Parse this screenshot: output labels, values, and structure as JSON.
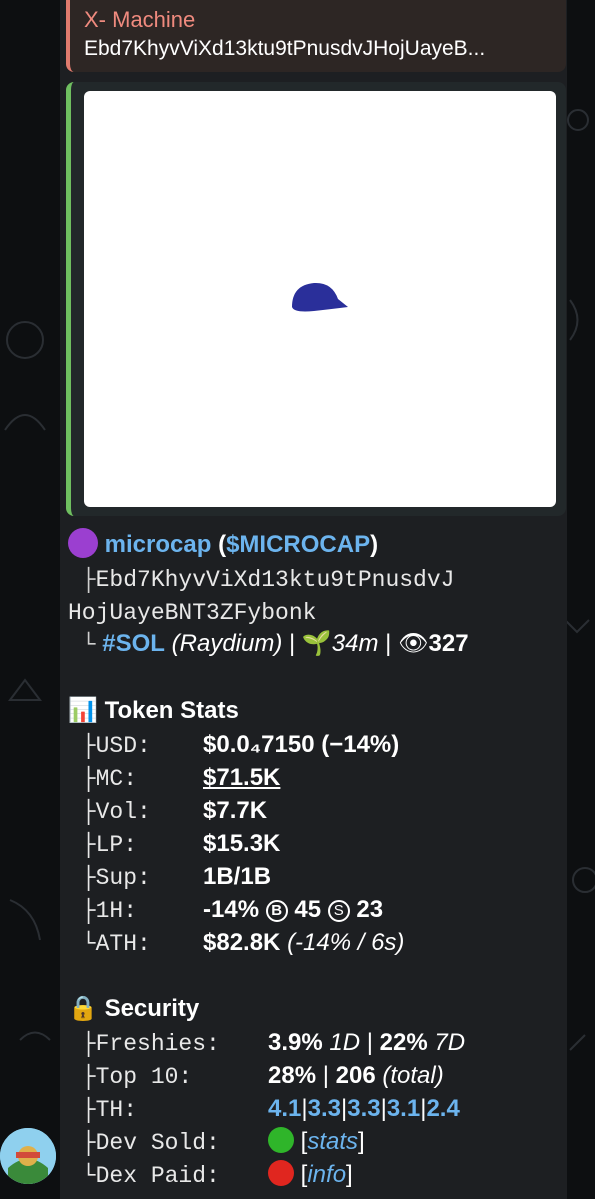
{
  "reply": {
    "author": "X- Machine",
    "text": "Ebd7KhyvViXd13ktu9tPnusdvJHojUayeB..."
  },
  "token": {
    "name": "microcap",
    "ticker": "$MICROCAP",
    "address_line1": "Ebd7KhyvViXd13ktu9tPnusdvJ",
    "address_line2": "HojUayeBNT3ZFybonk",
    "chain": "#SOL",
    "dex": "(Raydium)",
    "age": "34m",
    "views": "327",
    "sep": "|"
  },
  "stats": {
    "title": "Token Stats",
    "rows": [
      {
        "label": "USD:",
        "value": "$0.0₄7150 (−14%)"
      },
      {
        "label": "MC:",
        "value": "$71.5K"
      },
      {
        "label": "Vol:",
        "value": "$7.7K"
      },
      {
        "label": "LP:",
        "value": "$15.3K"
      },
      {
        "label": "Sup:",
        "value": "1B/1B"
      },
      {
        "label": "1H:",
        "value": "-14%",
        "b_letter": "B",
        "b_val": "45",
        "s_letter": "S",
        "s_val": "23"
      },
      {
        "label": "ATH:",
        "value": "$82.8K",
        "extra": "(-14% / 6s)"
      }
    ]
  },
  "security": {
    "title": "Security",
    "freshies_label": "Freshies:",
    "freshies_1d": "3.9%",
    "freshies_1d_unit": "1D",
    "freshies_7d": "22%",
    "freshies_7d_unit": "7D",
    "top10_label": "Top 10:",
    "top10_pct": "28%",
    "top10_count": "206",
    "top10_unit": "(total)",
    "th_label": "TH:",
    "th_values": [
      "4.1",
      "3.3",
      "3.3",
      "3.1",
      "2.4"
    ],
    "dev_sold_label": "Dev Sold:",
    "dev_sold_link": "stats",
    "dex_paid_label": "Dex Paid:",
    "dex_paid_link": "info"
  },
  "colors": {
    "link": "#6cb4ee",
    "accent_reply": "#e07b6e",
    "accent_preview": "#6fbf60",
    "green_dot": "#2fb52a",
    "red_dot": "#e0261f"
  },
  "icons": {
    "token_dot": "purple-circle-icon",
    "age": "seedling-icon",
    "views": "eye-icon",
    "stats": "bar-chart-icon",
    "security": "lock-icon"
  }
}
